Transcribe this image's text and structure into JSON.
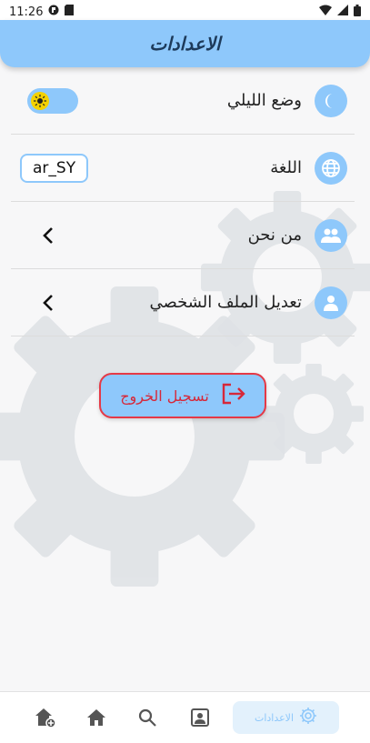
{
  "status_bar": {
    "time": "11:26"
  },
  "app_bar": {
    "title": "الاعدادات"
  },
  "settings": {
    "dark_mode": {
      "label": "وضع الليلي",
      "icon": "moon-icon",
      "toggle_icon": "sun-icon",
      "enabled": false
    },
    "language": {
      "label": "اللغة",
      "icon": "globe-icon",
      "value": "ar_SY"
    },
    "about": {
      "label": "من نحن",
      "icon": "group-icon",
      "trailing_icon": "chevron-left-icon"
    },
    "edit_profile": {
      "label": "تعديل الملف الشخصي",
      "icon": "person-icon",
      "trailing_icon": "chevron-left-icon"
    }
  },
  "logout": {
    "label": "تسجيل الخروج",
    "icon": "logout-icon"
  },
  "bottom_nav": {
    "items": [
      {
        "name": "add-home",
        "icon": "home-add-icon"
      },
      {
        "name": "home",
        "icon": "home-icon"
      },
      {
        "name": "search",
        "icon": "search-icon"
      },
      {
        "name": "profile",
        "icon": "portrait-icon"
      }
    ],
    "active": {
      "label": "الاعدادات",
      "icon": "gear-icon"
    }
  },
  "colors": {
    "accent": "#8ec8fb",
    "accent_dark": "#1d3a5a",
    "danger": "#e53946",
    "background": "#f7f7f8"
  }
}
